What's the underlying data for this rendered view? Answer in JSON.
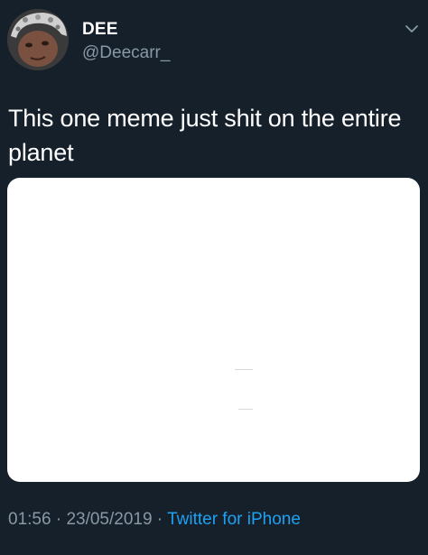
{
  "author": {
    "display_name": "DEE",
    "handle": "@Deecarr_"
  },
  "tweet": {
    "text": "This one meme just shit on the entire planet"
  },
  "meta": {
    "time": "01:56",
    "separator": " · ",
    "date": "23/05/2019",
    "source": "Twitter for iPhone"
  },
  "icons": {
    "menu": "chevron-down-icon",
    "avatar": "profile-photo"
  },
  "colors": {
    "background": "#15202b",
    "secondary_text": "#8899a6",
    "link": "#1da1f2"
  }
}
